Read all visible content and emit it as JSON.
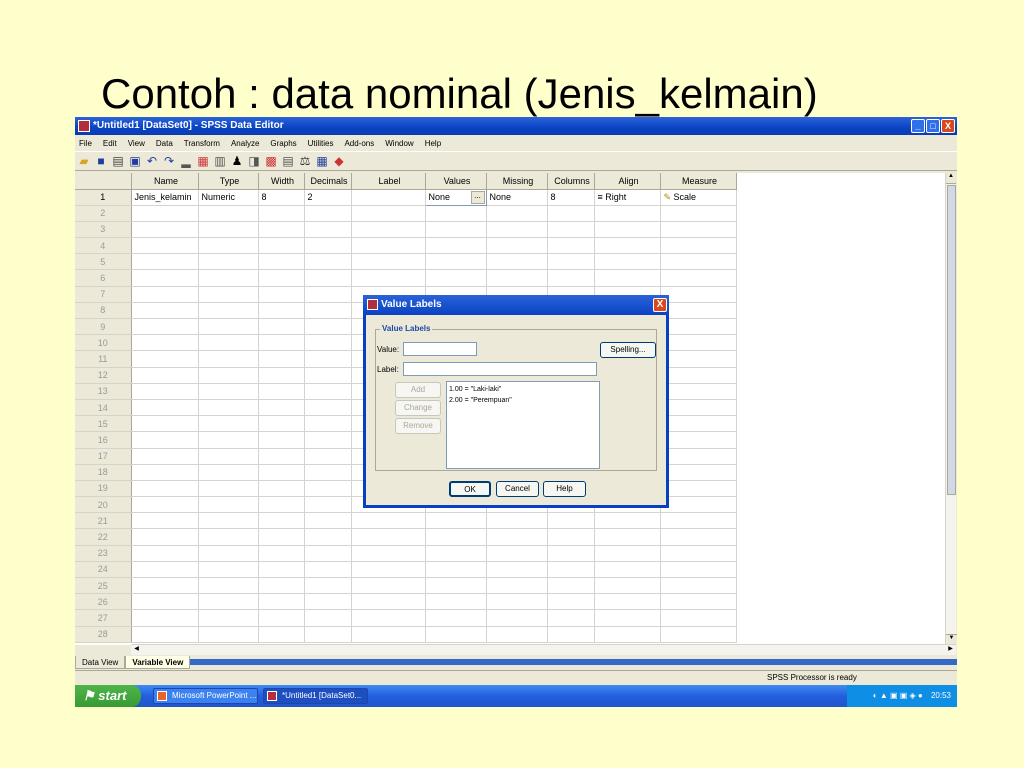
{
  "slide": {
    "title": "Contoh : data nominal (Jenis_kelmain)"
  },
  "window": {
    "title": "*Untitled1 [DataSet0] - SPSS Data Editor",
    "min": "_",
    "max": "□",
    "close": "X"
  },
  "menu": [
    "File",
    "Edit",
    "View",
    "Data",
    "Transform",
    "Analyze",
    "Graphs",
    "Utilities",
    "Add-ons",
    "Window",
    "Help"
  ],
  "toolbar_icons": [
    "folder-open-icon",
    "save-icon",
    "print-icon",
    "dialog-recall-icon",
    "undo-icon",
    "redo-icon",
    "goto-case-icon",
    "insert-case-icon",
    "insert-variable-icon",
    "find-icon",
    "split-icon",
    "weight-icon",
    "select-icon",
    "value-labels-icon",
    "use-sets-icon",
    "chart-icon"
  ],
  "columns": [
    "Name",
    "Type",
    "Width",
    "Decimals",
    "Label",
    "Values",
    "Missing",
    "Columns",
    "Align",
    "Measure"
  ],
  "rows": [
    {
      "n": "1",
      "cells": [
        "Jenis_kelamin",
        "Numeric",
        "8",
        "2",
        "",
        "None",
        "None",
        "8",
        "Right",
        "Scale"
      ]
    }
  ],
  "row_count": 28,
  "values_button": "...",
  "align_icon": "align-right-icon",
  "measure_icon": "ruler-icon",
  "tabs": {
    "data": "Data View",
    "variable": "Variable View"
  },
  "status": "SPSS  Processor  is ready",
  "taskbar": {
    "start": "start",
    "tasks": [
      "Microsoft PowerPoint ...",
      "*Untitled1 [DataSet0..."
    ],
    "clock": "20:53"
  },
  "dialog": {
    "title": "Value Labels",
    "close": "X",
    "group": "Value Labels",
    "value_label": "Value:",
    "value_value": "",
    "label_label": "Label:",
    "label_value": "",
    "spelling": "Spelling...",
    "add": "Add",
    "change": "Change",
    "remove": "Remove",
    "list": [
      "1.00 = \"Laki-laki\"",
      "2.00 = \"Perempuan\""
    ],
    "ok": "OK",
    "cancel": "Cancel",
    "help": "Help"
  }
}
